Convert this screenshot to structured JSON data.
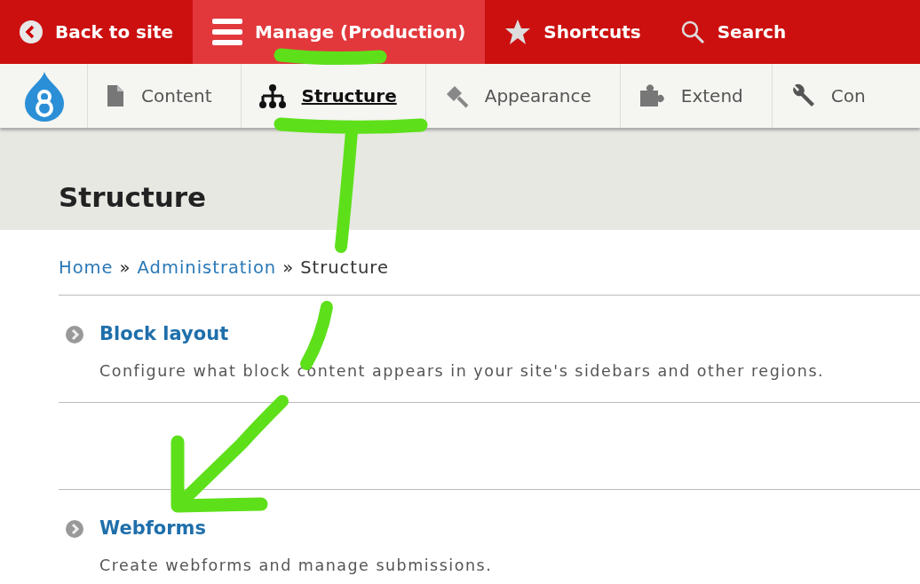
{
  "toolbar": [
    {
      "label": "Back to site",
      "kind": "back",
      "selected": false
    },
    {
      "label": "Manage (Production)",
      "kind": "manage",
      "selected": true
    },
    {
      "label": "Shortcuts",
      "kind": "shortcuts",
      "selected": false
    },
    {
      "label": "Search",
      "kind": "search",
      "selected": false
    }
  ],
  "tray": [
    {
      "label": "Content",
      "kind": "content",
      "selected": false
    },
    {
      "label": "Structure",
      "kind": "structure",
      "selected": true
    },
    {
      "label": "Appearance",
      "kind": "appearance",
      "selected": false
    },
    {
      "label": "Extend",
      "kind": "extend",
      "selected": false
    },
    {
      "label": "Con",
      "kind": "config",
      "selected": false
    }
  ],
  "page_title": "Structure",
  "breadcrumb": [
    {
      "label": "Home",
      "kind": "link"
    },
    {
      "label": "»",
      "kind": "separator"
    },
    {
      "label": "Administration",
      "kind": "link"
    },
    {
      "label": "»",
      "kind": "separator"
    },
    {
      "label": "Structure",
      "kind": "current"
    }
  ],
  "sections": [
    {
      "title": "Block layout",
      "description": "Configure what block content appears in your site's sidebars and other regions."
    },
    {
      "title": "Webforms",
      "description": "Create webforms and manage submissions."
    }
  ]
}
